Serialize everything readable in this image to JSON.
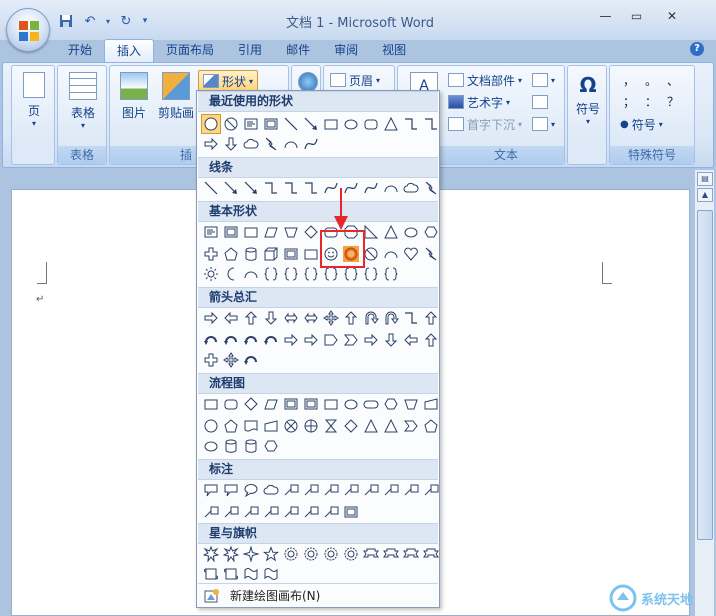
{
  "window": {
    "title": "文档 1 - Microsoft Word",
    "help": "?"
  },
  "qat": {
    "items": [
      "save",
      "undo",
      "redo",
      "customize"
    ]
  },
  "tabs": [
    "开始",
    "插入",
    "页面布局",
    "引用",
    "邮件",
    "审阅",
    "视图"
  ],
  "active_tab": "插入",
  "ribbon": {
    "page_btn": "页",
    "table_btn": "表格",
    "table_group": "表格",
    "picture_btn": "图片",
    "clipart_btn": "剪贴画",
    "illus_group_partial": "插",
    "shapes_btn": "形状",
    "header_btn": "页眉",
    "textbox_label": "A",
    "docparts_btn": "文档部件",
    "wordart_btn": "艺术字",
    "dropcap_btn": "首字下沉",
    "text_group": "文本",
    "symbol_btn": "符号",
    "symbol_glyph": "Ω",
    "special_symbols_btn": "符号",
    "special_group": "特殊符号",
    "special_glyphs": [
      "，",
      "。",
      "、",
      "；",
      "：",
      "？"
    ]
  },
  "shapes_menu": {
    "sections": [
      "最近使用的形状",
      "线条",
      "基本形状",
      "箭头总汇",
      "流程图",
      "标注",
      "星与旗帜"
    ],
    "new_canvas": "新建绘图画布(N)"
  },
  "document": {
    "paragraph_mark": "↵"
  },
  "highlight_color": "#e8262b",
  "watermark": {
    "text": "系统天地"
  }
}
